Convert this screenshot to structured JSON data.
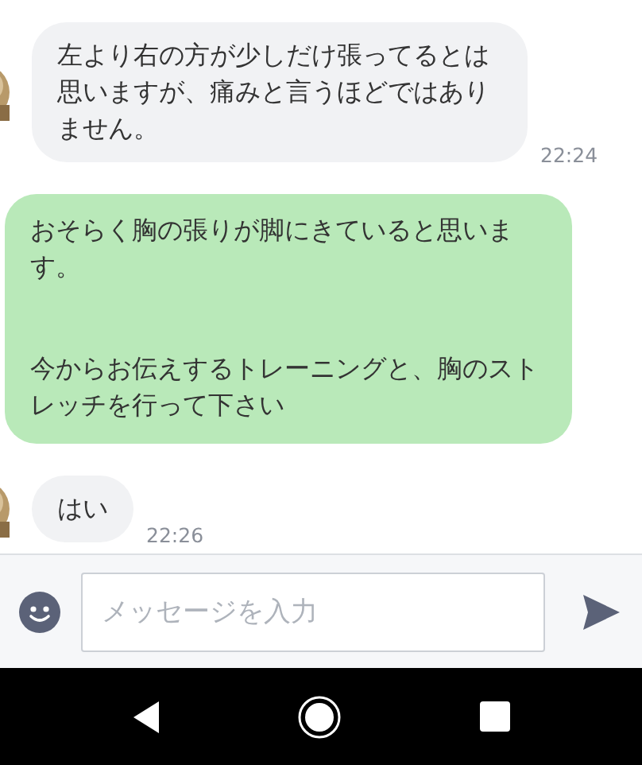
{
  "messages": [
    {
      "kind": "received",
      "paragraphs": [
        "左より右の方が少しだけ張ってるとは思いますが、痛みと言うほどではありません。"
      ],
      "time": "22:24"
    },
    {
      "kind": "sent",
      "paragraphs": [
        "おそらく胸の張りが脚にきていると思います。",
        "今からお伝えするトレーニングと、胸のストレッチを行って下さい"
      ]
    },
    {
      "kind": "received",
      "paragraphs": [
        "はい"
      ],
      "time": "22:26"
    }
  ],
  "input": {
    "placeholder": "メッセージを入力"
  }
}
